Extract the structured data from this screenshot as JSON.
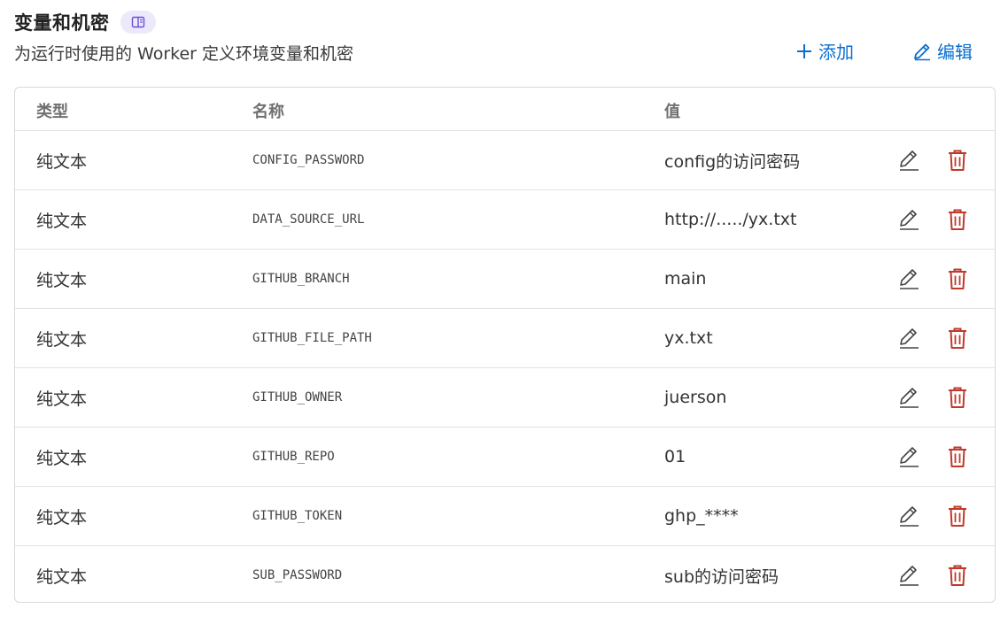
{
  "header": {
    "title": "变量和机密",
    "docs_icon": "book-icon",
    "subtitle": "为运行时使用的 Worker 定义环境变量和机密",
    "add_label": "添加",
    "edit_label": "编辑"
  },
  "table": {
    "columns": {
      "type": "类型",
      "name": "名称",
      "value": "值"
    },
    "rows": [
      {
        "type": "纯文本",
        "name": "CONFIG_PASSWORD",
        "value": "config的访问密码"
      },
      {
        "type": "纯文本",
        "name": "DATA_SOURCE_URL",
        "value": "http://...../yx.txt"
      },
      {
        "type": "纯文本",
        "name": "GITHUB_BRANCH",
        "value": "main"
      },
      {
        "type": "纯文本",
        "name": "GITHUB_FILE_PATH",
        "value": "yx.txt"
      },
      {
        "type": "纯文本",
        "name": "GITHUB_OWNER",
        "value": "juerson"
      },
      {
        "type": "纯文本",
        "name": "GITHUB_REPO",
        "value": "01"
      },
      {
        "type": "纯文本",
        "name": "GITHUB_TOKEN",
        "value": "ghp_****"
      },
      {
        "type": "纯文本",
        "name": "SUB_PASSWORD",
        "value": "sub的访问密码"
      }
    ]
  },
  "colors": {
    "accent": "#0a6ecf",
    "delete": "#c0392b",
    "badge_bg": "#ece9fb",
    "badge_icon": "#6b4fd8"
  }
}
